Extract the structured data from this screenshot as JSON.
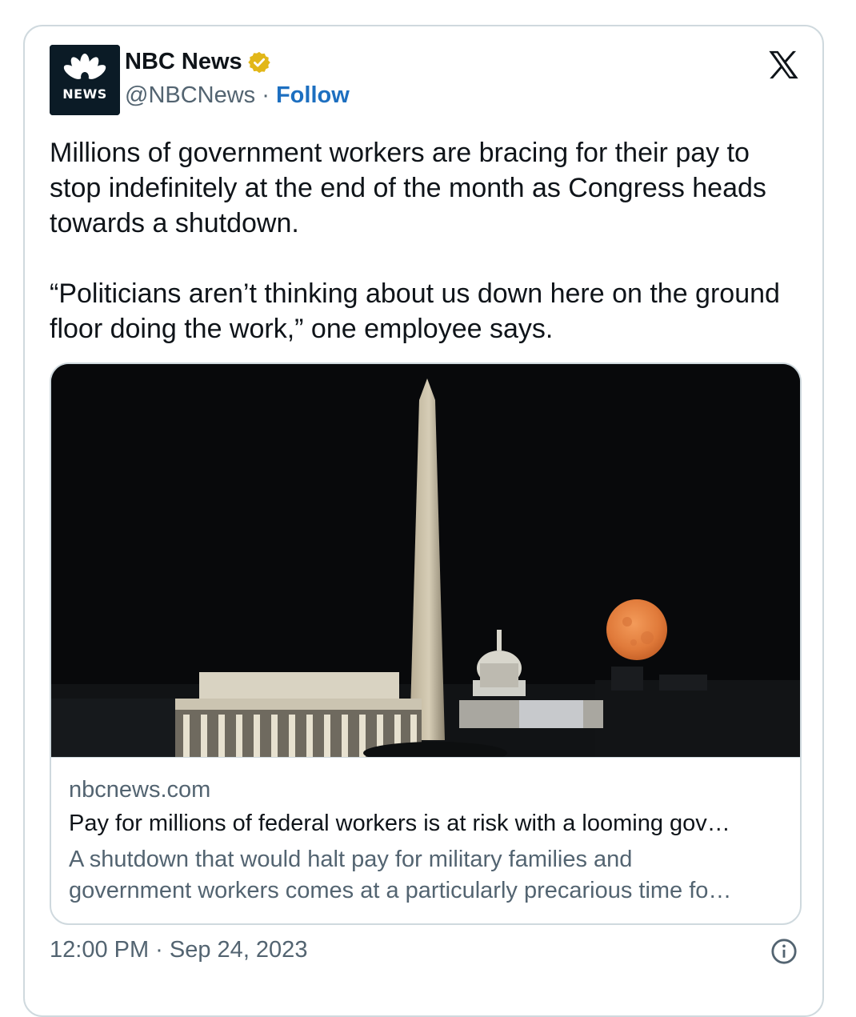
{
  "author": {
    "name": "NBC News",
    "handle": "@NBCNews",
    "separator": " · ",
    "follow_label": "Follow",
    "avatar_text": "NEWS",
    "verified_color": "#e2b719"
  },
  "platform_icon": "x-logo-icon",
  "tweet": {
    "paragraphs": [
      "Millions of government workers are bracing for their pay to stop indefinitely at the end of the month as Congress heads towards a shutdown.",
      "“Politicians aren’t thinking about us down here on the ground floor doing the work,” one employee says."
    ]
  },
  "link_card": {
    "domain": "nbcnews.com",
    "title": "Pay for millions of federal workers is at risk with a looming gov…",
    "description_line1": "A shutdown that would halt pay for military families and",
    "description_line2": "government workers comes at a particularly precarious time fo…"
  },
  "footer": {
    "timestamp": "12:00 PM · Sep 24, 2023",
    "info_icon": "info-icon"
  },
  "colors": {
    "accent": "#1d6fc0",
    "secondary_text": "#536471",
    "border": "#cfd9de"
  }
}
